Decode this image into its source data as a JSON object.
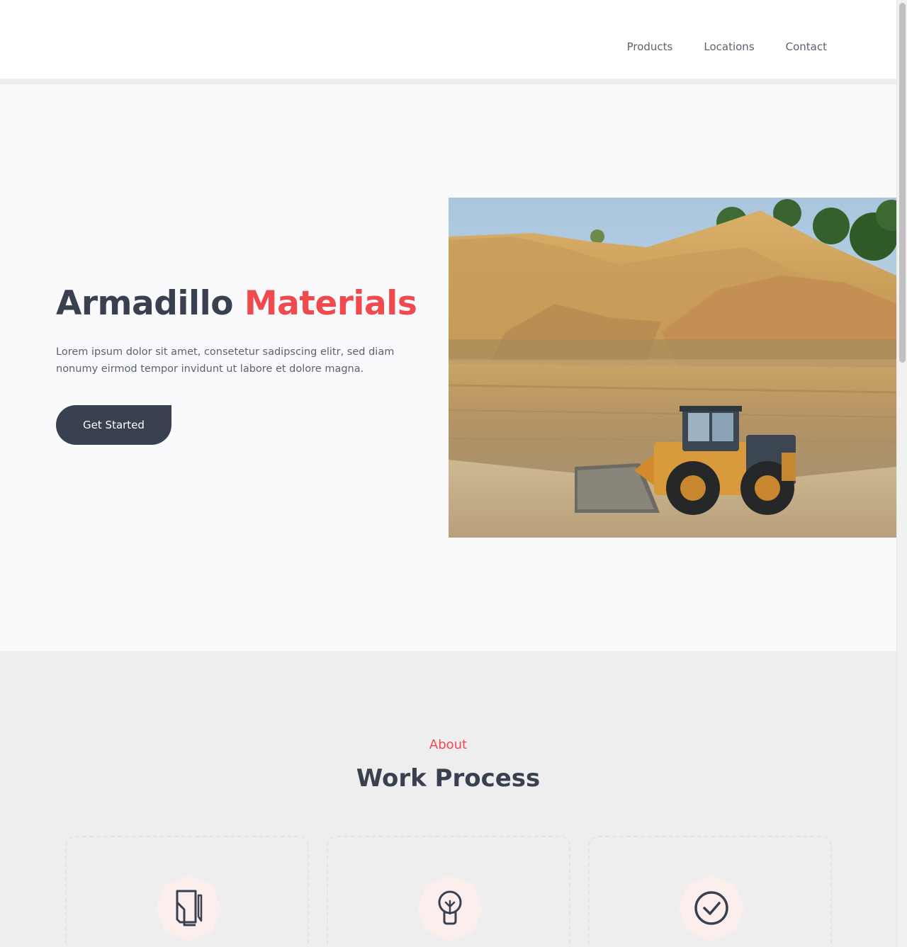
{
  "nav": {
    "items": [
      {
        "label": "Products"
      },
      {
        "label": "Locations"
      },
      {
        "label": "Contact"
      }
    ]
  },
  "hero": {
    "title_main": "Armadillo",
    "title_accent": "Materials",
    "description": "Lorem ipsum dolor sit amet, consetetur sadipscing elitr, sed diam nonumy eirmod tempor invidunt ut labore et dolore magna.",
    "cta_label": "Get Started"
  },
  "about": {
    "eyebrow": "About",
    "title": "Work Process",
    "cards": [
      {
        "icon": "document-icon"
      },
      {
        "icon": "lightbulb-icon"
      },
      {
        "icon": "check-circle-icon"
      }
    ]
  },
  "colors": {
    "accent": "#f04a4f",
    "dark": "#394150",
    "icon_bg": "#fdeeee"
  }
}
